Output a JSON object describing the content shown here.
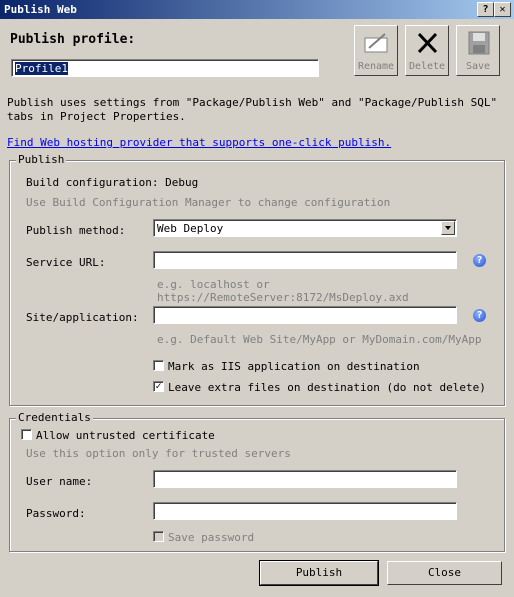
{
  "window": {
    "title": "Publish Web",
    "help_label": "?",
    "close_label": "✕"
  },
  "profile": {
    "heading": "Publish profile:",
    "value": "Profile1",
    "rename_label": "Rename",
    "delete_label": "Delete",
    "save_label": "Save"
  },
  "intro": {
    "description": "Publish uses settings from \"Package/Publish Web\" and \"Package/Publish SQL\" tabs in Project Properties.",
    "link": "Find Web hosting provider that supports one-click publish."
  },
  "publish": {
    "legend": "Publish",
    "build_config": "Build configuration: Debug",
    "build_hint": "Use Build Configuration Manager to change configuration",
    "method_label": "Publish method:",
    "method_value": "Web Deploy",
    "service_url_label": "Service URL:",
    "service_url_value": "",
    "service_url_hint": "e.g. localhost or https://RemoteServer:8172/MsDeploy.axd",
    "site_label": "Site/application:",
    "site_value": "",
    "site_hint": "e.g. Default Web Site/MyApp or MyDomain.com/MyApp",
    "mark_iis_label": "Mark as IIS application on destination",
    "mark_iis_checked": false,
    "leave_files_label": "Leave extra files on destination (do not delete)",
    "leave_files_checked": true
  },
  "credentials": {
    "legend": "Credentials",
    "allow_untrusted_label": "Allow untrusted certificate",
    "allow_untrusted_checked": false,
    "untrusted_hint": "Use this option only for trusted servers",
    "username_label": "User name:",
    "username_value": "",
    "password_label": "Password:",
    "password_value": "",
    "save_password_label": "Save password",
    "save_password_checked": false
  },
  "footer": {
    "publish_label": "Publish",
    "close_label": "Close"
  },
  "icons": {
    "help": "question-circle-icon",
    "rename": "rename-icon",
    "delete": "x-icon",
    "save": "floppy-disk-icon"
  },
  "colors": {
    "window_bg": "#d4d0c8",
    "title_start": "#0a246a",
    "title_end": "#a6caf0",
    "link": "#0000ee",
    "hint": "#808080"
  }
}
